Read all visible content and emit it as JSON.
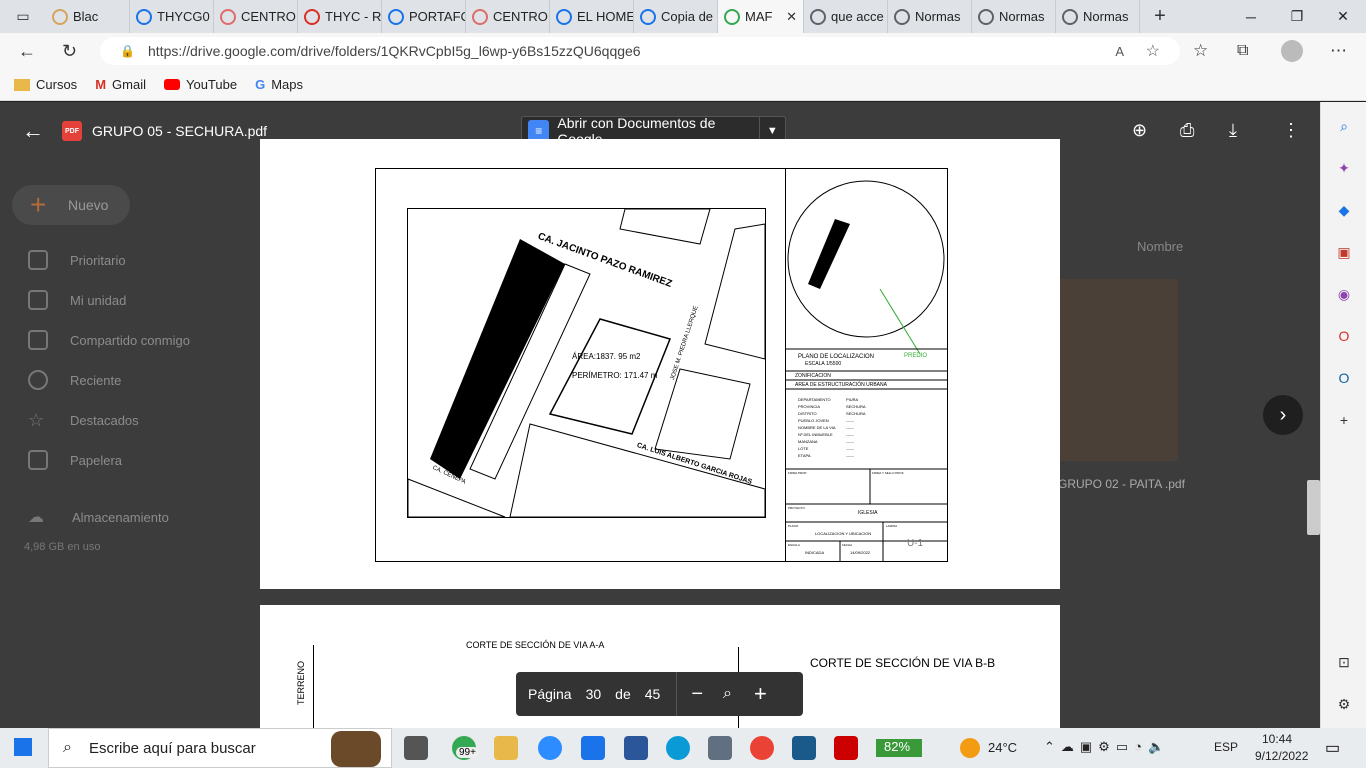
{
  "browser": {
    "tabs": [
      {
        "label": "Blac",
        "color": "#d6a35c"
      },
      {
        "label": "THYCG0",
        "color": "#1a73e8"
      },
      {
        "label": "CENTRO",
        "color": "#e06b6b"
      },
      {
        "label": "THYC - R",
        "color": "#d93025"
      },
      {
        "label": "PORTAFC",
        "color": "#1a73e8"
      },
      {
        "label": "CENTRO",
        "color": "#e06b6b"
      },
      {
        "label": "EL HOME",
        "color": "#1a73e8"
      },
      {
        "label": "Copia de",
        "color": "#1a73e8"
      },
      {
        "label": "MAF",
        "color": "#34a853",
        "active": true
      },
      {
        "label": "que acce",
        "color": "#5f6368"
      },
      {
        "label": "Normas",
        "color": "#5f6368"
      },
      {
        "label": "Normas",
        "color": "#5f6368"
      },
      {
        "label": "Normas",
        "color": "#5f6368"
      }
    ],
    "url": "https://drive.google.com/drive/folders/1QKRvCpbI5g_l6wp-y6Bs15zzQU6qqge6",
    "bookmarks": [
      "Cursos",
      "Gmail",
      "YouTube",
      "Maps"
    ]
  },
  "drive": {
    "new_label": "Nuevo",
    "nav": [
      "Prioritario",
      "Mi unidad",
      "Compartido conmigo",
      "Reciente",
      "Destacados",
      "Papelera",
      "Almacenamiento"
    ],
    "storage_used": "4,98 GB en uso",
    "sort_label": "Nombre",
    "right_file": "GRUPO 02 - PAITA .pdf"
  },
  "viewer": {
    "file_name": "GRUPO 05 - SECHURA.pdf",
    "open_with": "Abrir con Documentos de Google",
    "page_label": "Página",
    "current_page": "30",
    "of_label": "de",
    "total_pages": "45"
  },
  "plan": {
    "street_top": "CA. JACINTO PAZO RAMIREZ",
    "street_bottom": "CA. LUIS ALBERTO GARCIA ROJAS",
    "street_left": "CA. CENEPA",
    "street_right": "JOSE M. PIEDRA LLERQUE",
    "area": "ÁREA:1837. 95  m2",
    "perimeter": "PERÍMETRO: 171.47 m",
    "predio": "PREDIO",
    "plano_title": "PLANO DE LOCALIZACION",
    "escala_small": "ESCALA 1/5500",
    "zonificacion": "ZONIFICACION",
    "area_estructuracion": "AREA DE ESTRUCTURACIÓN URBANA",
    "info_rows": [
      {
        "k": "DEPARTAMENTO",
        "v": "PIURA"
      },
      {
        "k": "PROVINCIA",
        "v": "SECHURA"
      },
      {
        "k": "DISTRITO",
        "v": "SECHURA"
      },
      {
        "k": "PUEBLO JOVEN",
        "v": "------"
      },
      {
        "k": "NOMBRE DE LA VIA",
        "v": "------"
      },
      {
        "k": "Nº DEL INMUEBLE",
        "v": "------"
      },
      {
        "k": "MANZANA",
        "v": "------"
      },
      {
        "k": "LOTE",
        "v": "------"
      },
      {
        "k": "ETAPA",
        "v": "------"
      }
    ],
    "firma_prop": "FIRMA PROP.",
    "firma_sello": "FIRMA Y SELLO PROF.",
    "proyecto_label": "PROYECTO",
    "proyecto": "IGLESIA",
    "plano_label": "PLANO",
    "plano": "LOCALIZACION  Y  UBICACION",
    "lamina_label": "LAMINA",
    "lamina": "U-1",
    "escala_label": "ESCALA",
    "escala": "INDICADA",
    "fecha_label": "FECHA",
    "fecha": "14/09/2022"
  },
  "page2": {
    "corte_a": "CORTE DE SECCIÓN DE VIA A-A",
    "corte_b": "CORTE DE SECCIÓN DE VIA B-B",
    "terreno": "TERRENO"
  },
  "taskbar": {
    "search_placeholder": "Escribe aquí para buscar",
    "badge": "99+",
    "battery": "82%",
    "temperature": "24°C",
    "lang": "ESP",
    "time": "10:44",
    "date": "9/12/2022"
  }
}
